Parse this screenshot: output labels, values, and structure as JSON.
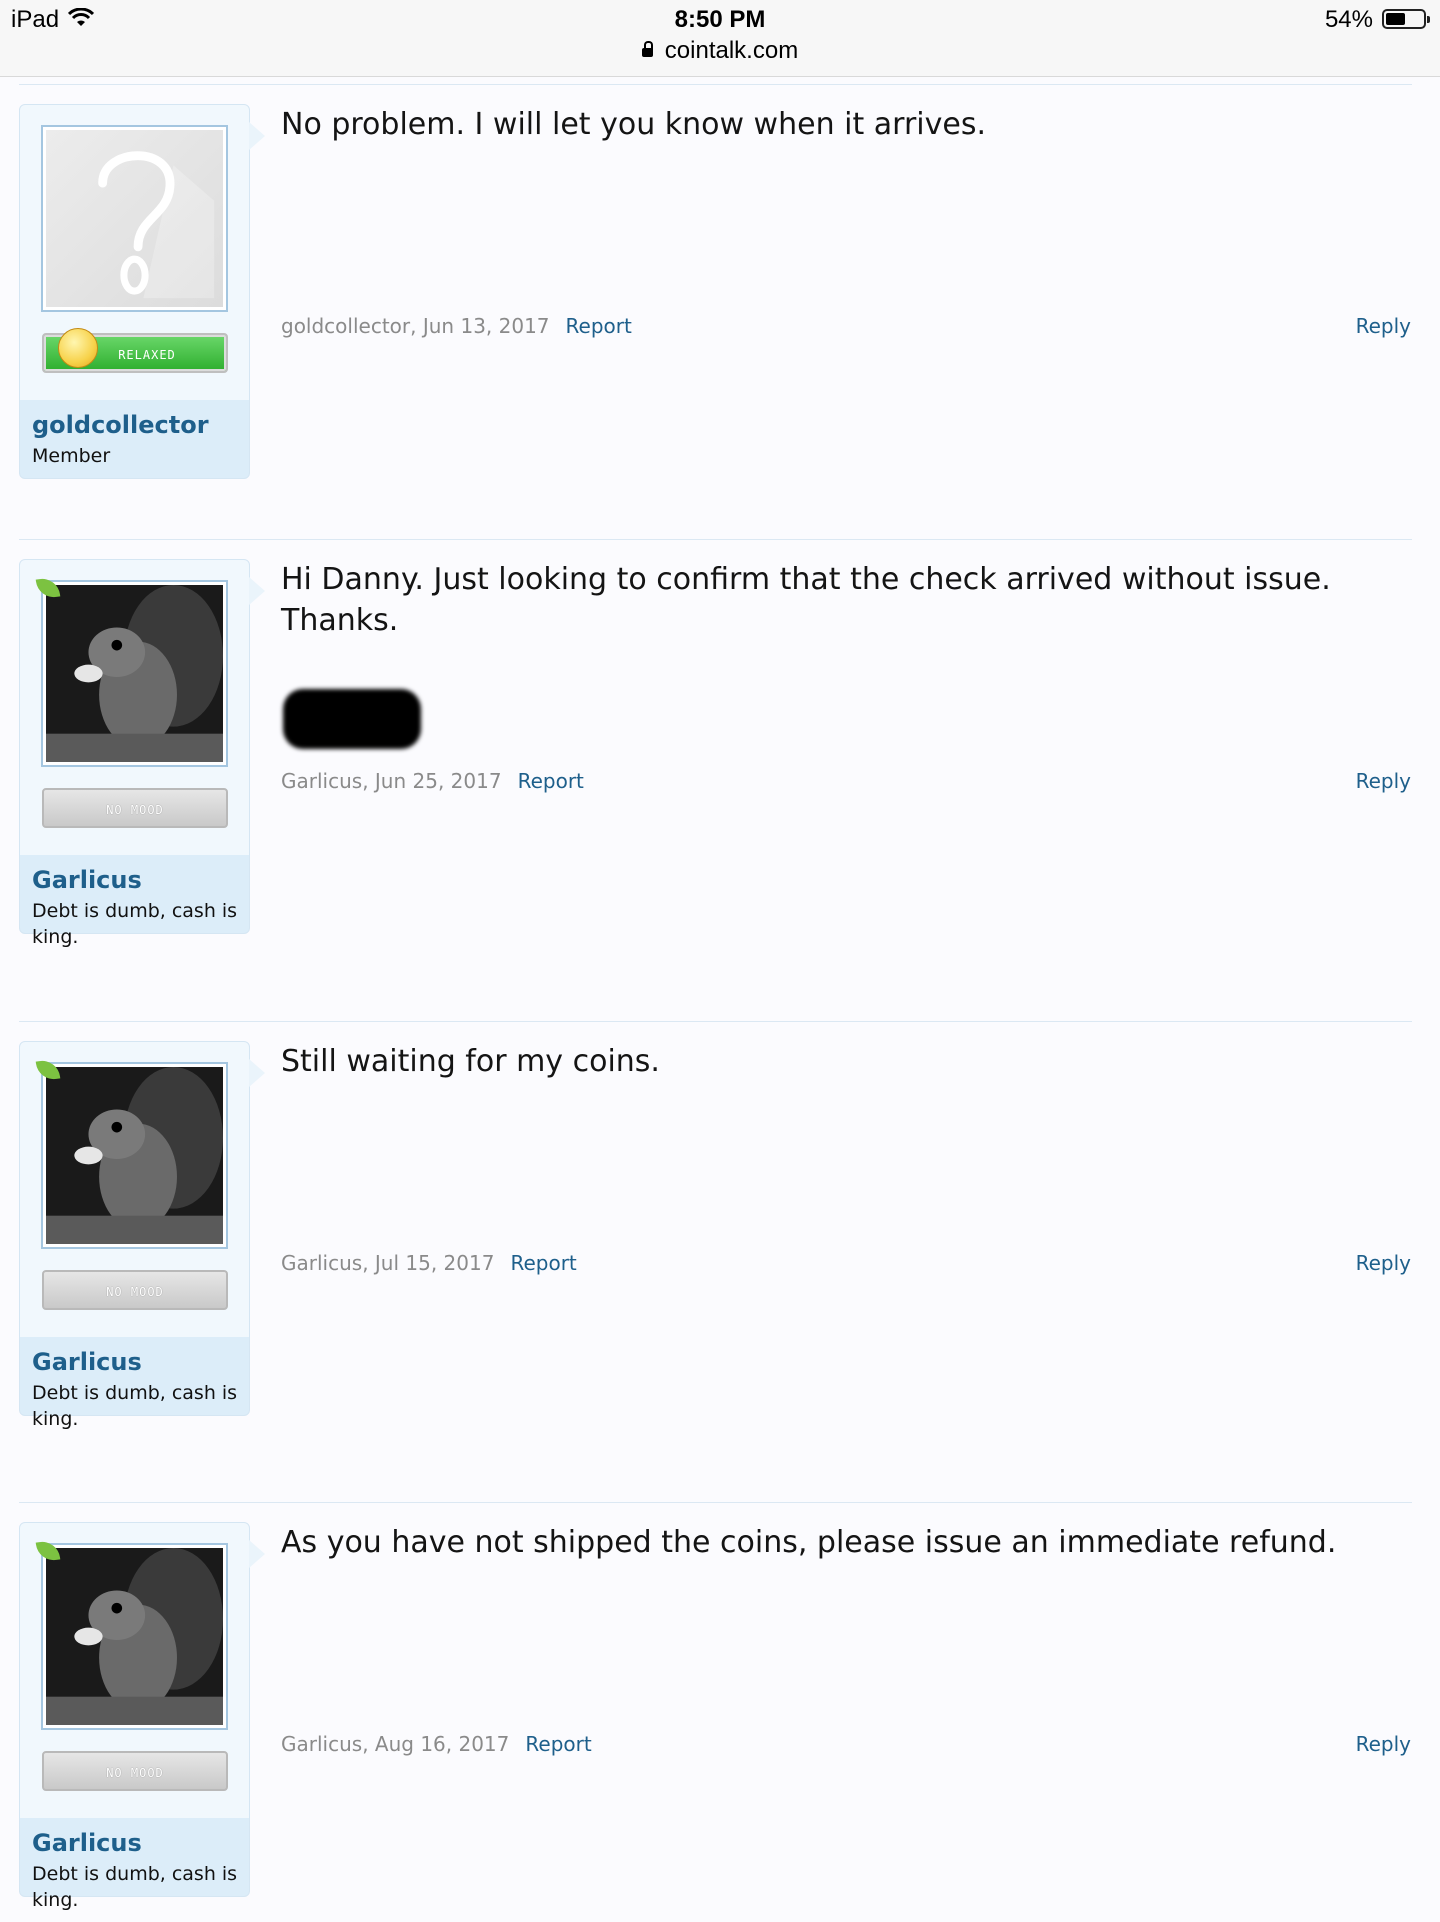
{
  "status_bar": {
    "device": "iPad",
    "time": "8:50 PM",
    "url": "cointalk.com",
    "battery_pct": "54%",
    "battery_level": 0.54
  },
  "posts": [
    {
      "username": "goldcollector",
      "user_title": "Member",
      "mood": "RELAXED",
      "avatar": "default-avatar",
      "message": "No problem. I will let you know when it arrives.",
      "author": "goldcollector",
      "date": "Jun 13, 2017",
      "report_label": "Report",
      "reply_label": "Reply"
    },
    {
      "username": "Garlicus",
      "user_title": "Debt is dumb, cash is king.",
      "mood": "NO MOOD",
      "avatar": "squirrel-avatar",
      "message": "Hi Danny. Just looking to confirm that the check arrived without issue. Thanks.",
      "author": "Garlicus",
      "date": "Jun 25, 2017",
      "report_label": "Report",
      "reply_label": "Reply"
    },
    {
      "username": "Garlicus",
      "user_title": "Debt is dumb, cash is king.",
      "mood": "NO MOOD",
      "avatar": "squirrel-avatar",
      "message": "Still waiting for my coins.",
      "author": "Garlicus",
      "date": "Jul 15, 2017",
      "report_label": "Report",
      "reply_label": "Reply"
    },
    {
      "username": "Garlicus",
      "user_title": "Debt is dumb, cash is king.",
      "mood": "NO MOOD",
      "avatar": "squirrel-avatar",
      "message": "As you have not shipped the coins, please issue an immediate refund.",
      "author": "Garlicus",
      "date": "Aug 16, 2017",
      "report_label": "Report",
      "reply_label": "Reply"
    }
  ]
}
